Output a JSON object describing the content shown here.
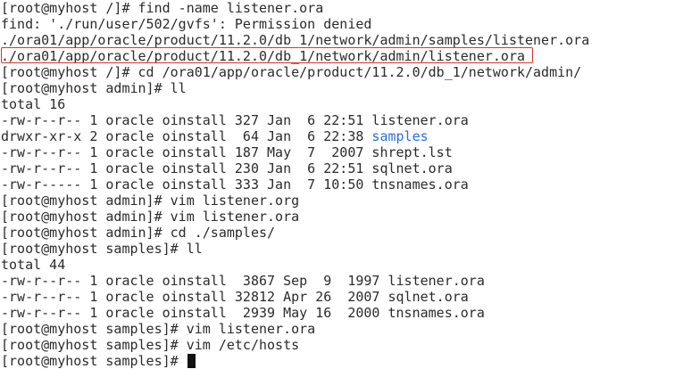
{
  "terminal": {
    "lines": [
      "[root@myhost /]# find -name listener.ora",
      "find: './run/user/502/gvfs': Permission denied",
      "./ora01/app/oracle/product/11.2.0/db_1/network/admin/samples/listener.ora",
      "./ora01/app/oracle/product/11.2.0/db_1/network/admin/listener.ora",
      "[root@myhost /]# cd /ora01/app/oracle/product/11.2.0/db_1/network/admin/",
      "[root@myhost admin]# ll",
      "total 16",
      "-rw-r--r-- 1 oracle oinstall 327 Jan  6 22:51 listener.ora",
      "drwxr-xr-x 2 oracle oinstall  64 Jan  6 22:38 ",
      "-rw-r--r-- 1 oracle oinstall 187 May  7  2007 shrept.lst",
      "-rw-r--r-- 1 oracle oinstall 230 Jan  6 22:51 sqlnet.ora",
      "-rw-r----- 1 oracle oinstall 333 Jan  7 10:50 tnsnames.ora",
      "[root@myhost admin]# vim listener.org",
      "[root@myhost admin]# vim listener.ora",
      "[root@myhost admin]# cd ./samples/",
      "[root@myhost samples]# ll",
      "total 44",
      "-rw-r--r-- 1 oracle oinstall  3867 Sep  9  1997 listener.ora",
      "-rw-r--r-- 1 oracle oinstall 32812 Apr 26  2007 sqlnet.ora",
      "-rw-r--r-- 1 oracle oinstall  2939 May 16  2000 tnsnames.ora",
      "[root@myhost samples]# vim listener.ora",
      "[root@myhost samples]# vim /etc/hosts",
      "[root@myhost samples]# "
    ],
    "directory_name": "samples",
    "colors": {
      "text": "#2b2b2b",
      "directory": "#2a6fd6",
      "highlight_border": "#e0302a",
      "background": "#ffffff"
    }
  }
}
